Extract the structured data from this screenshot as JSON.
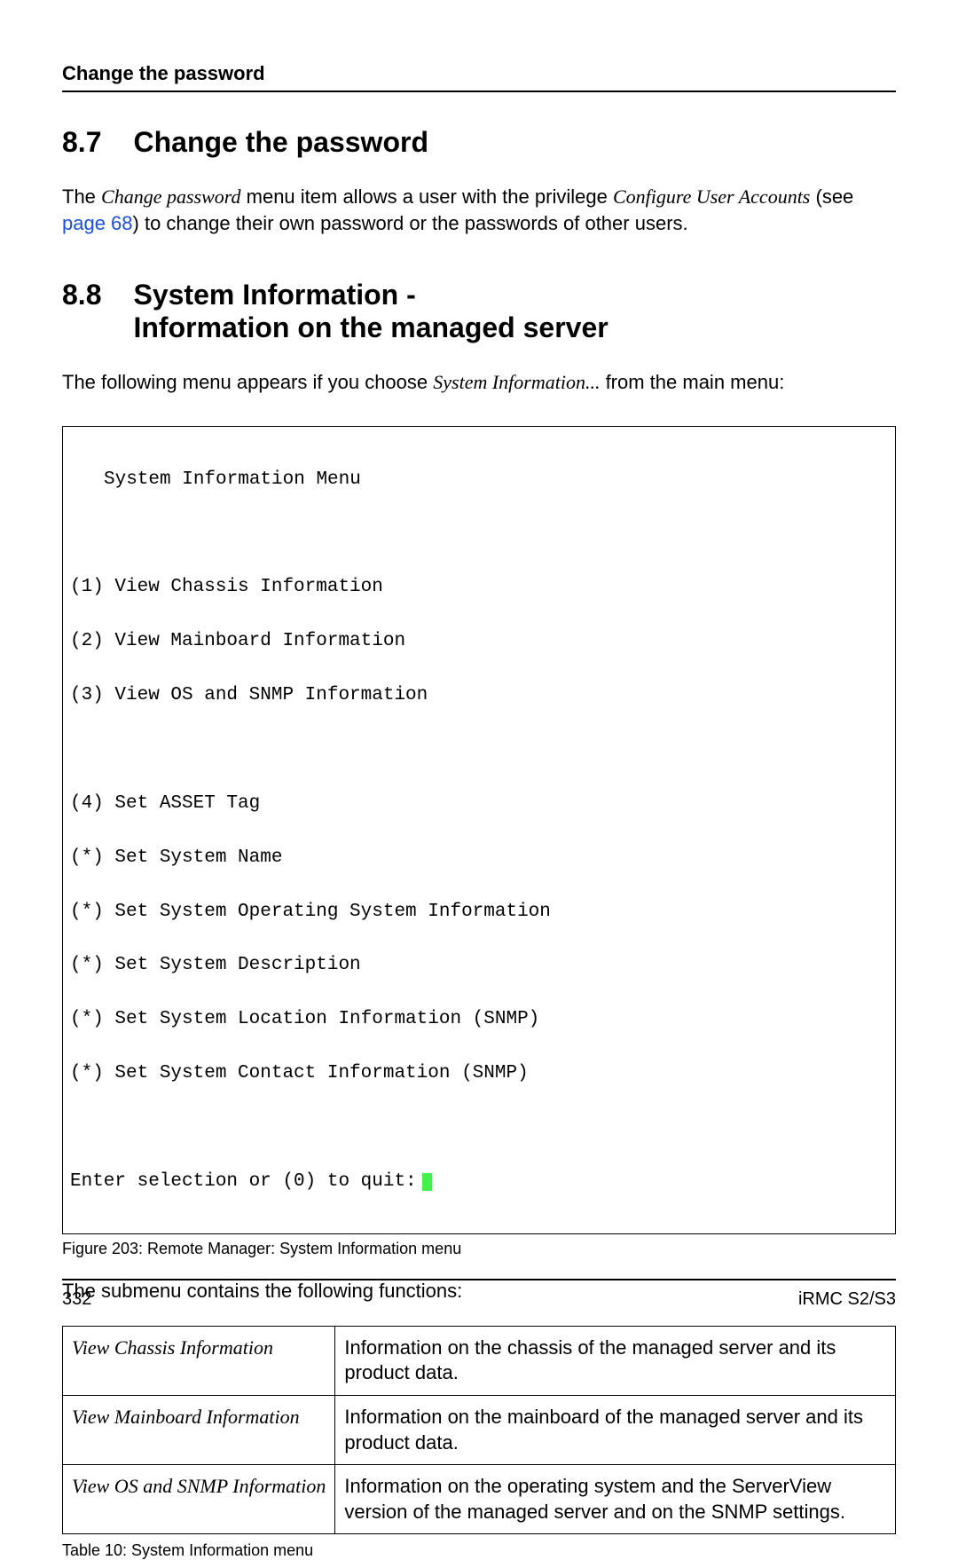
{
  "running_head": "Change the password",
  "section1": {
    "num": "8.7",
    "title": "Change the password",
    "para_pre": "The ",
    "para_i1": "Change password",
    "para_mid1": " menu item allows a user with the privilege ",
    "para_i2": "Configure User Accounts",
    "para_mid2": " (see ",
    "para_link": "page 68",
    "para_post": ") to change their own password or the passwords of other users."
  },
  "section2": {
    "num": "8.8",
    "title": "System Information -\nInformation on the managed server",
    "para_pre": "The following menu appears if you choose ",
    "para_i1": "System Information...",
    "para_post": " from the main menu:"
  },
  "menu": {
    "header": "System Information Menu",
    "items": [
      "(1) View Chassis Information",
      "(2) View Mainboard Information",
      "(3) View OS and SNMP Information",
      "",
      "(4) Set ASSET Tag",
      "(*) Set System Name",
      "(*) Set System Operating System Information",
      "(*) Set System Description",
      "(*) Set System Location Information (SNMP)",
      "(*) Set System Contact Information (SNMP)"
    ],
    "prompt": "Enter selection or (0) to quit:"
  },
  "figure_caption": "Figure 203: Remote Manager: System Information menu",
  "submenu_text": "The submenu contains the following functions:",
  "table": {
    "rows": [
      {
        "left": "View Chassis Information",
        "right": "Information on the chassis of the managed server and its product data."
      },
      {
        "left": "View Mainboard Information",
        "right": "Information on the mainboard of the managed server and its product data."
      },
      {
        "left": "View OS and SNMP Information",
        "right": "Information on the operating system and the ServerView version of the managed server and on the SNMP settings."
      }
    ]
  },
  "table_caption": "Table 10: System Information menu",
  "footer": {
    "page": "332",
    "doc": "iRMC S2/S3"
  }
}
